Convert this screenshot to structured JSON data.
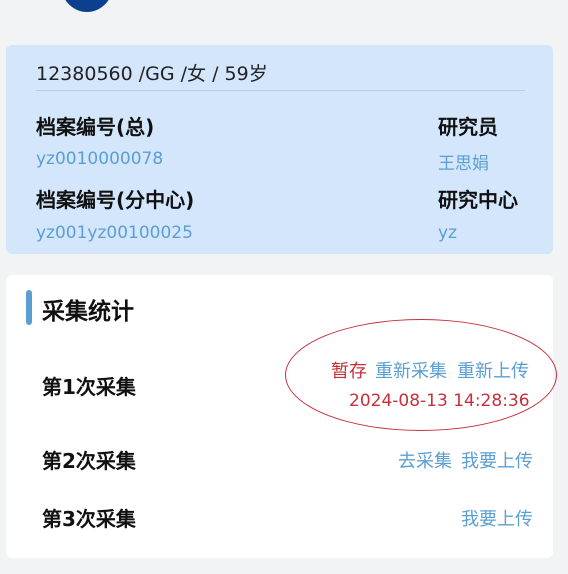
{
  "patient": {
    "summary": "12380560 /GG /女 / 59岁"
  },
  "record": {
    "archive_total_label": "档案编号(总)",
    "archive_total_value": "yz0010000078",
    "archive_sub_label": "档案编号(分中心)",
    "archive_sub_value": "yz001yz00100025",
    "researcher_label": "研究员",
    "researcher_value": "王思娟",
    "center_label": "研究中心",
    "center_value": "yz"
  },
  "stats": {
    "title": "采集统计",
    "rows": [
      {
        "label": "第1次采集",
        "status": "暂存",
        "actions": [
          "重新采集",
          "重新上传"
        ],
        "timestamp": "2024-08-13 14:28:36"
      },
      {
        "label": "第2次采集",
        "actions": [
          "去采集",
          "我要上传"
        ]
      },
      {
        "label": "第3次采集",
        "actions": [
          "我要上传"
        ]
      }
    ]
  },
  "colors": {
    "accent_blue": "#5b9fd2",
    "status_red": "#c7303a",
    "info_card_bg": "#d3e6fb",
    "avatar": "#0d3f8f"
  }
}
